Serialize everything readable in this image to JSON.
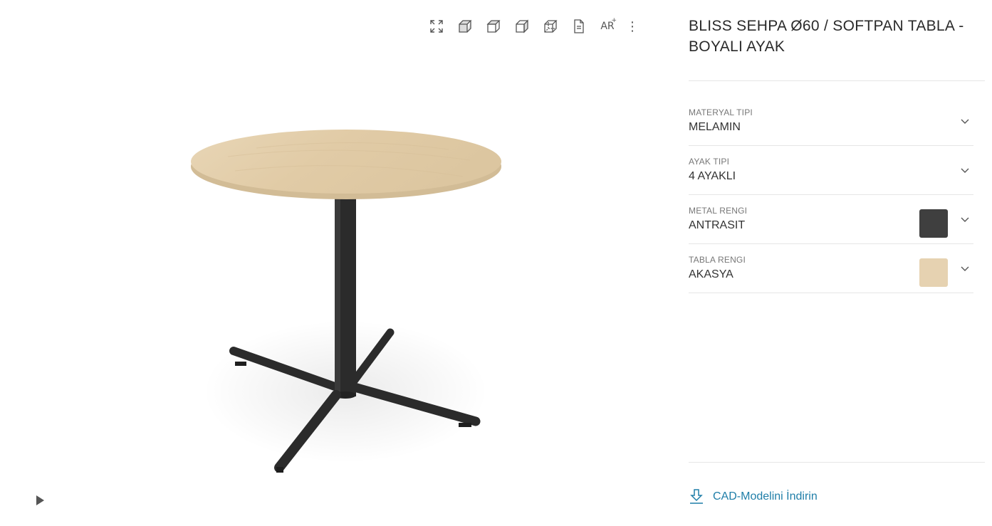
{
  "toolbar": {
    "icons": [
      "fullscreen-icon",
      "cube-front-icon",
      "cube-top-icon",
      "cube-side-icon",
      "cube-iso-icon",
      "document-icon",
      "ar-icon",
      "more-icon"
    ],
    "ar_label": "AR",
    "ar_plus": "+",
    "more_label": "⋮"
  },
  "product": {
    "title": "BLISS SEHPA Ø60 / SOFTPAN TABLA - BOYALI AYAK"
  },
  "options": [
    {
      "label": "MATERYAL TIPI",
      "value": "MELAMIN"
    },
    {
      "label": "AYAK TIPI",
      "value": "4 AYAKLI"
    },
    {
      "label": "METAL RENGI",
      "value": "ANTRASIT",
      "swatch_color": "#3f3f3f"
    },
    {
      "label": "TABLA RENGI",
      "value": "AKASYA",
      "swatch_color": "#e6d2b1"
    }
  ],
  "cad": {
    "label": "CAD-Modelini İndirin",
    "icon": "download-icon"
  },
  "colors": {
    "accent": "#1f7ea8",
    "table_top": "#e3cfad",
    "metal": "#2b2b2b"
  }
}
